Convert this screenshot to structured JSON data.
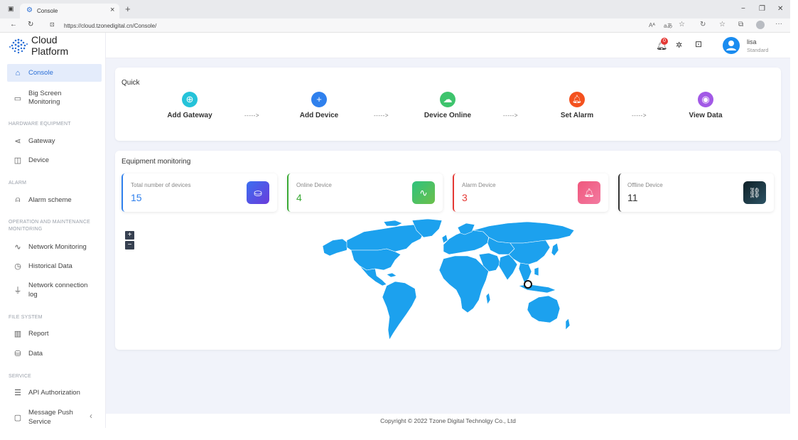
{
  "browser": {
    "tab_title": "Console",
    "url": "https://cloud.tzonedigital.cn/Console/",
    "tab_close": "×",
    "new_tab": "+",
    "reader_mode": "Aᴬ",
    "aa": "aあ",
    "window_minimize": "−",
    "window_restore": "❐",
    "window_close": "✕"
  },
  "logo": {
    "line1": "Cloud",
    "line2": "Platform"
  },
  "sidebar": {
    "console": "Console",
    "big_screen_1": "Big Screen",
    "big_screen_2": "Monitoring",
    "section_hardware": "HARDWARE EQUIPMENT",
    "gateway": "Gateway",
    "device": "Device",
    "section_alarm": "ALARM",
    "alarm_scheme": "Alarm scheme",
    "section_om_1": "OPERATION AND MAINTENANCE",
    "section_om_2": "MONITORING",
    "network_monitoring": "Network Monitoring",
    "historical_data": "Historical Data",
    "network_log_1": "Network connection",
    "network_log_2": "log",
    "section_file": "FILE SYSTEM",
    "report": "Report",
    "data": "Data",
    "section_service": "SERVICE",
    "api_auth": "API Authorization",
    "message_push_1": "Message Push",
    "message_push_2": "Service",
    "collapse": "‹"
  },
  "header": {
    "notification_count": "0",
    "user_name": "lisa",
    "user_role": "Standard"
  },
  "quick": {
    "title": "Quick",
    "arrow": "----->",
    "items": [
      {
        "label": "Add Gateway",
        "icon": "plus-circle-icon",
        "color": "#25c3d9"
      },
      {
        "label": "Add Device",
        "icon": "plus-icon",
        "color": "#2f80ed"
      },
      {
        "label": "Device Online",
        "icon": "cloud-icon",
        "color": "#3ec46d"
      },
      {
        "label": "Set Alarm",
        "icon": "bell-icon",
        "color": "#f4511e"
      },
      {
        "label": "View Data",
        "icon": "eye-icon",
        "color": "#a259e6"
      }
    ]
  },
  "monitoring": {
    "title": "Equipment monitoring",
    "stats": [
      {
        "label": "Total number of devices",
        "value": "15",
        "color": "#2f80ed",
        "icon": "device-icon",
        "icon_bg": "#5b3fe0"
      },
      {
        "label": "Online Device",
        "value": "4",
        "color": "#3aaa35",
        "icon": "pulse-icon",
        "icon_bg": "#3ec46d"
      },
      {
        "label": "Alarm Device",
        "value": "3",
        "color": "#e53935",
        "icon": "bell-icon",
        "icon_bg": "#ef5b8a"
      },
      {
        "label": "Offline Device",
        "value": "11",
        "color": "#333333",
        "icon": "unlink-icon",
        "icon_bg": "#1f2d3a"
      }
    ],
    "zoom_in": "+",
    "zoom_out": "−",
    "map_color": "#1ca1ee"
  },
  "footer": {
    "copyright": "Copyright © 2022 Tzone Digital Technolgy Co., Ltd"
  }
}
